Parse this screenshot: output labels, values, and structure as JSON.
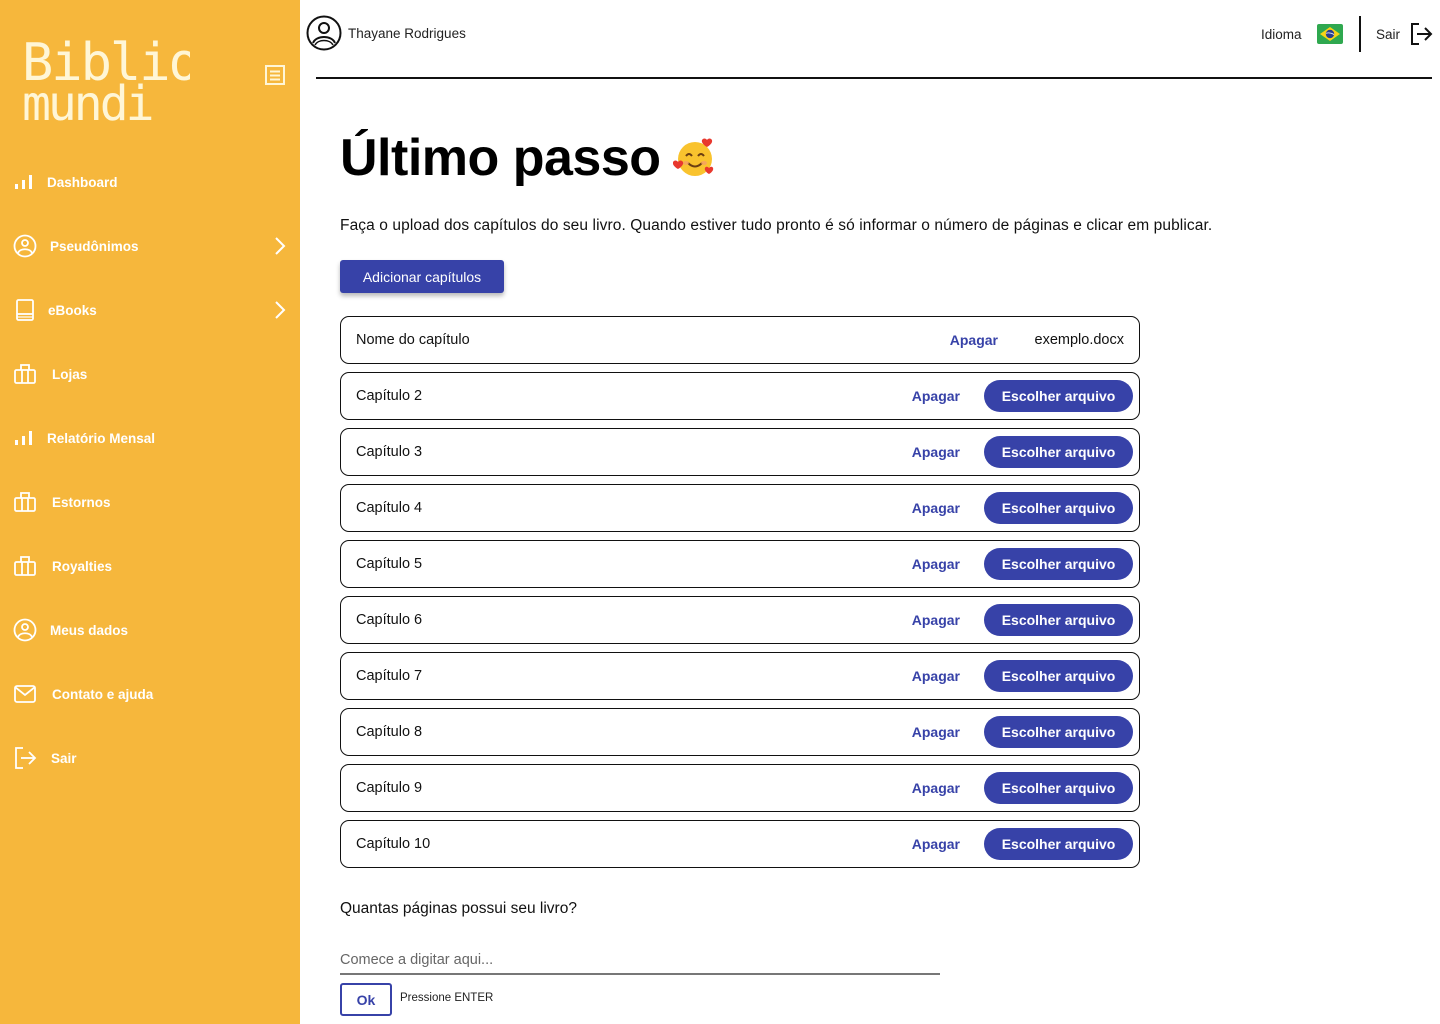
{
  "brand": {
    "line1": "Biblio",
    "line2": "mundi"
  },
  "colors": {
    "sidebar": "#F6B73C",
    "accent": "#3742A8",
    "text": "#111111"
  },
  "sidebar": {
    "items": [
      {
        "label": "Dashboard",
        "icon": "bar-chart-icon",
        "has_chevron": false
      },
      {
        "label": "Pseudônimos",
        "icon": "user-circle-icon",
        "has_chevron": true
      },
      {
        "label": "eBooks",
        "icon": "book-icon",
        "has_chevron": true
      },
      {
        "label": "Lojas",
        "icon": "store-icon",
        "has_chevron": false
      },
      {
        "label": "Relatório Mensal",
        "icon": "bar-chart-icon",
        "has_chevron": false
      },
      {
        "label": "Estornos",
        "icon": "store-icon",
        "has_chevron": false
      },
      {
        "label": "Royalties",
        "icon": "store-icon",
        "has_chevron": false
      },
      {
        "label": "Meus dados",
        "icon": "user-circle-icon",
        "has_chevron": false
      },
      {
        "label": "Contato e ajuda",
        "icon": "mail-icon",
        "has_chevron": false
      },
      {
        "label": "Sair",
        "icon": "logout-icon",
        "has_chevron": false
      }
    ]
  },
  "header": {
    "user_name": "Thayane Rodrigues",
    "language_label": "Idioma",
    "language_flag": "brazil-flag",
    "logout_label": "Sair"
  },
  "main": {
    "title": "Último passo",
    "title_emoji": "smiling-face-with-hearts",
    "subtitle": "Faça o upload dos capítulos do seu livro. Quando estiver tudo pronto é só informar o número de páginas e clicar em publicar.",
    "add_chapters_label": "Adicionar capítulos",
    "delete_label": "Apagar",
    "choose_file_label": "Escolher arquivo",
    "chapters": [
      {
        "name": "Nome do capítulo",
        "file": "exemplo.docx"
      },
      {
        "name": "Capítulo 2",
        "file": null
      },
      {
        "name": "Capítulo 3",
        "file": null
      },
      {
        "name": "Capítulo 4",
        "file": null
      },
      {
        "name": "Capítulo 5",
        "file": null
      },
      {
        "name": "Capítulo 6",
        "file": null
      },
      {
        "name": "Capítulo 7",
        "file": null
      },
      {
        "name": "Capítulo 8",
        "file": null
      },
      {
        "name": "Capítulo 9",
        "file": null
      },
      {
        "name": "Capítulo 10",
        "file": null
      }
    ],
    "pages_question": "Quantas páginas possui seu livro?",
    "pages_input": {
      "value": "",
      "placeholder": "Comece a digitar aqui..."
    },
    "ok_label": "Ok",
    "enter_hint": "Pressione ENTER"
  }
}
